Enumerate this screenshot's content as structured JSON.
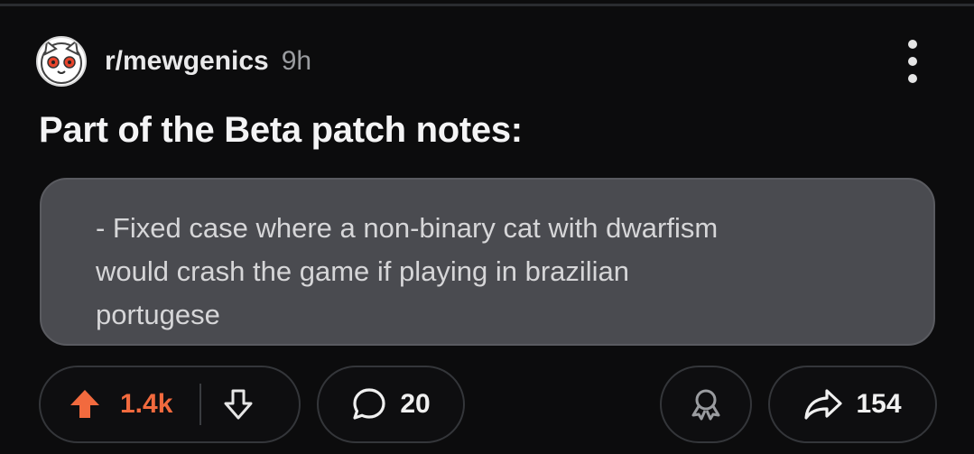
{
  "post": {
    "subreddit": "r/mewgenics",
    "age": "9h",
    "title": "Part of the Beta patch notes:",
    "body": "- Fixed case where a non-binary cat with dwarfism\nwould crash the game if playing in brazilian\nportugese"
  },
  "actions": {
    "upvotes": "1.4k",
    "comments": "20",
    "shares": "154"
  },
  "icons": {
    "avatar": "cat-face-icon",
    "menu": "more-vertical-icon",
    "upvote": "arrow-up-icon",
    "downvote": "arrow-down-icon",
    "comment": "speech-bubble-icon",
    "award": "award-ribbon-icon",
    "share": "share-arrow-icon"
  },
  "colors": {
    "upvote_active": "#f26a3e",
    "background": "#0c0c0d",
    "body_box": "#4a4b50"
  }
}
